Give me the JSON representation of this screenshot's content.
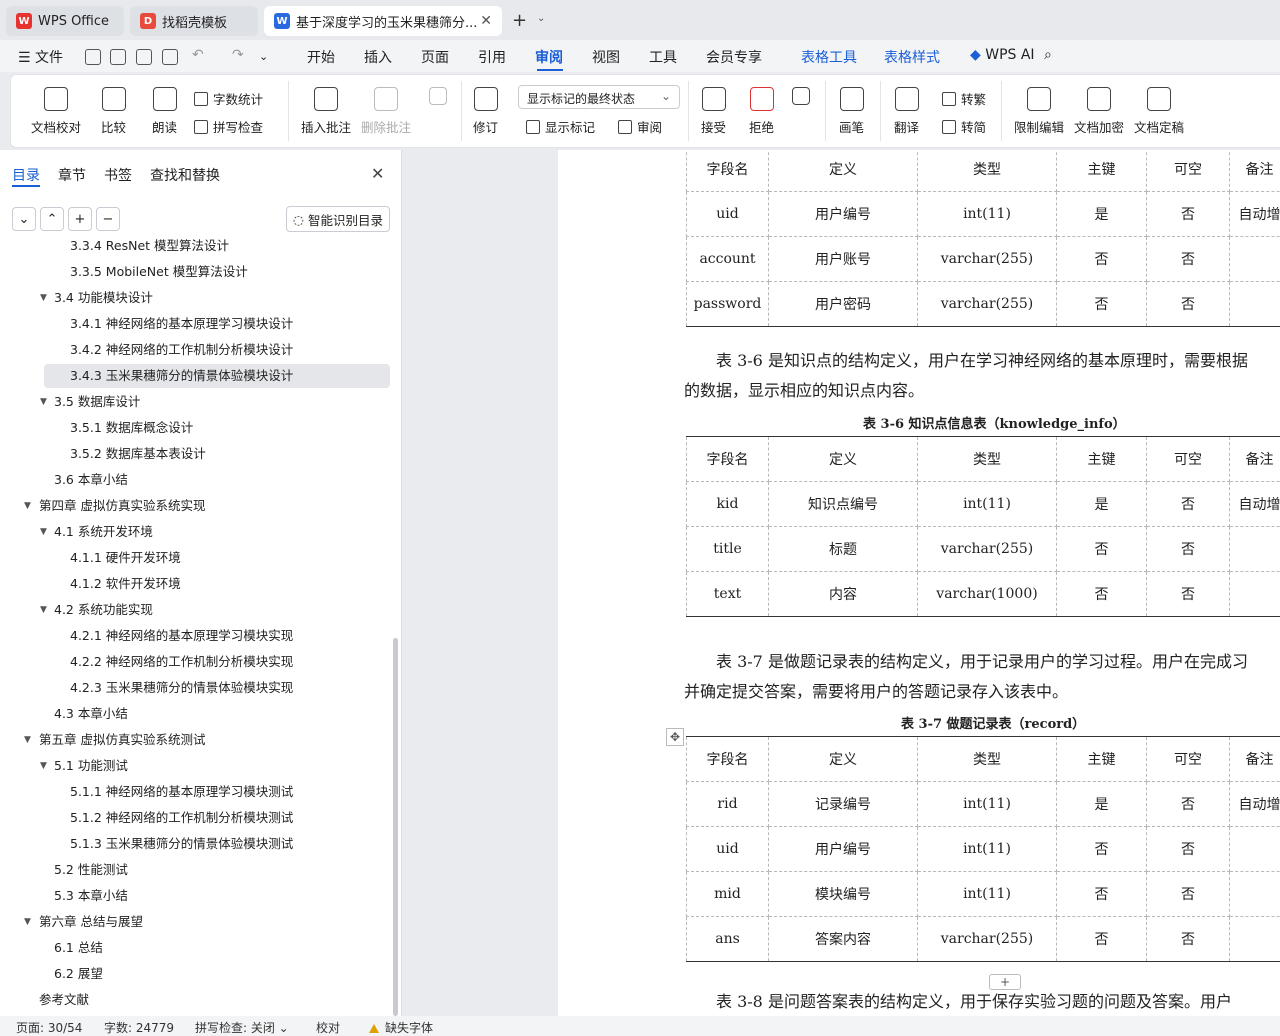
{
  "tabs": [
    {
      "label": "WPS Office"
    },
    {
      "label": "找稻壳模板"
    },
    {
      "label": "基于深度学习的玉米果穗筛分..."
    }
  ],
  "menu": {
    "file": "文件",
    "items": [
      "开始",
      "插入",
      "页面",
      "引用",
      "审阅",
      "视图",
      "工具",
      "会员专享",
      "表格工具",
      "表格样式"
    ],
    "wps_ai": "WPS AI"
  },
  "ribbon": {
    "doc_check": "文档校对",
    "compare": "比较",
    "read_aloud": "朗读",
    "word_count": "字数统计",
    "spell_check": "拼写检查",
    "insert_comment": "插入批注",
    "delete_comment": "删除批注",
    "track": "修订",
    "markup_state": "显示标记的最终状态",
    "show_markup": "显示标记",
    "review": "审阅",
    "accept": "接受",
    "reject": "拒绝",
    "pen": "画笔",
    "translate": "翻译",
    "to_traditional": "转繁",
    "to_simplified": "转简",
    "restrict_edit": "限制编辑",
    "encrypt": "文档加密",
    "finalize": "文档定稿"
  },
  "pane": {
    "tabs": [
      "目录",
      "章节",
      "书签",
      "查找和替换"
    ],
    "smart_toc": "智能识别目录",
    "toc": [
      {
        "label": "3.3.4 ResNet 模型算法设计",
        "level": 3
      },
      {
        "label": "3.3.5 MobileNet 模型算法设计",
        "level": 3
      },
      {
        "label": "3.4 功能模块设计",
        "level": 2,
        "expanded": true
      },
      {
        "label": "3.4.1 神经网络的基本原理学习模块设计",
        "level": 3
      },
      {
        "label": "3.4.2 神经网络的工作机制分析模块设计",
        "level": 3
      },
      {
        "label": "3.4.3 玉米果穗筛分的情景体验模块设计",
        "level": 3,
        "selected": true
      },
      {
        "label": "3.5 数据库设计",
        "level": 2,
        "expanded": true
      },
      {
        "label": "3.5.1 数据库概念设计",
        "level": 3
      },
      {
        "label": "3.5.2 数据库基本表设计",
        "level": 3
      },
      {
        "label": "3.6 本章小结",
        "level": 2
      },
      {
        "label": "第四章 虚拟仿真实验系统实现",
        "level": 1,
        "expanded": true
      },
      {
        "label": "4.1 系统开发环境",
        "level": 2,
        "expanded": true
      },
      {
        "label": "4.1.1 硬件开发环境",
        "level": 3
      },
      {
        "label": "4.1.2 软件开发环境",
        "level": 3
      },
      {
        "label": "4.2 系统功能实现",
        "level": 2,
        "expanded": true
      },
      {
        "label": "4.2.1 神经网络的基本原理学习模块实现",
        "level": 3
      },
      {
        "label": "4.2.2 神经网络的工作机制分析模块实现",
        "level": 3
      },
      {
        "label": "4.2.3 玉米果穗筛分的情景体验模块实现",
        "level": 3
      },
      {
        "label": "4.3 本章小结",
        "level": 2
      },
      {
        "label": "第五章 虚拟仿真实验系统测试",
        "level": 1,
        "expanded": true
      },
      {
        "label": "5.1 功能测试",
        "level": 2,
        "expanded": true
      },
      {
        "label": "5.1.1 神经网络的基本原理学习模块测试",
        "level": 3
      },
      {
        "label": "5.1.2 神经网络的工作机制分析模块测试",
        "level": 3
      },
      {
        "label": "5.1.3 玉米果穗筛分的情景体验模块测试",
        "level": 3
      },
      {
        "label": "5.2 性能测试",
        "level": 2
      },
      {
        "label": "5.3 本章小结",
        "level": 2
      },
      {
        "label": "第六章 总结与展望",
        "level": 1,
        "expanded": true
      },
      {
        "label": "6.1 总结",
        "level": 2
      },
      {
        "label": "6.2 展望",
        "level": 2
      },
      {
        "label": "参考文献",
        "level": 1
      }
    ]
  },
  "document": {
    "header": [
      "字段名",
      "定义",
      "类型",
      "主键",
      "可空",
      "备注"
    ],
    "table1_rows": [
      [
        "uid",
        "用户编号",
        "int(11)",
        "是",
        "否",
        "自动增"
      ],
      [
        "account",
        "用户账号",
        "varchar(255)",
        "否",
        "否",
        ""
      ],
      [
        "password",
        "用户密码",
        "varchar(255)",
        "否",
        "否",
        ""
      ]
    ],
    "para1_line1": "表 3-6 是知识点的结构定义，用户在学习神经网络的基本原理时，需要根据",
    "para1_line2": "的数据，显示相应的知识点内容。",
    "caption2": "表 3-6 知识点信息表（knowledge_info）",
    "table2_rows": [
      [
        "kid",
        "知识点编号",
        "int(11)",
        "是",
        "否",
        "自动增"
      ],
      [
        "title",
        "标题",
        "varchar(255)",
        "否",
        "否",
        ""
      ],
      [
        "text",
        "内容",
        "varchar(1000)",
        "否",
        "否",
        ""
      ]
    ],
    "para2_line1": "表 3-7 是做题记录表的结构定义，用于记录用户的学习过程。用户在完成习",
    "para2_line2": "并确定提交答案，需要将用户的答题记录存入该表中。",
    "caption3": "表 3-7 做题记录表（record）",
    "table3_rows": [
      [
        "rid",
        "记录编号",
        "int(11)",
        "是",
        "否",
        "自动增"
      ],
      [
        "uid",
        "用户编号",
        "int(11)",
        "否",
        "否",
        ""
      ],
      [
        "mid",
        "模块编号",
        "int(11)",
        "否",
        "否",
        ""
      ],
      [
        "ans",
        "答案内容",
        "varchar(255)",
        "否",
        "否",
        ""
      ]
    ],
    "para3_partial": "表 3-8 是问题答案表的结构定义，用于保存实验习题的问题及答案。用户"
  },
  "status": {
    "page": "页面: 30/54",
    "words": "字数: 24779",
    "spell": "拼写检查: 关闭",
    "proof": "校对",
    "missing_font": "缺失字体"
  },
  "colors": {
    "accent": "#1a5fd6",
    "wps_red": "#e8322f",
    "docer_red": "#e84a3c",
    "writer_blue": "#2a6ae0"
  }
}
